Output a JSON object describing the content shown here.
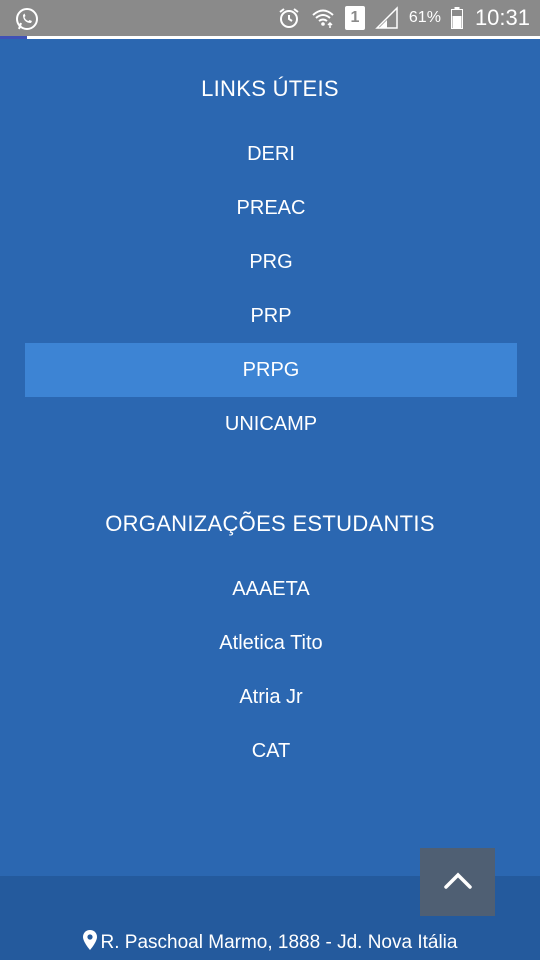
{
  "status_bar": {
    "sim_label": "1",
    "battery_pct": "61%",
    "time": "10:31"
  },
  "page_progress": 0.05,
  "links_section": {
    "title": "LINKS ÚTEIS",
    "items": [
      "DERI",
      "PREAC",
      "PRG",
      "PRP",
      "PRPG",
      "UNICAMP"
    ],
    "active_item": "PRPG"
  },
  "orgs_section": {
    "title": "ORGANIZAÇÕES ESTUDANTIS",
    "items": [
      "AAAETA",
      "Atletica Tito",
      "Atria Jr",
      "CAT"
    ]
  },
  "footer": {
    "address": "R. Paschoal Marmo, 1888 - Jd. Nova Itália"
  },
  "colors": {
    "background": "#2b67b1",
    "active_item": "#3d84d4",
    "footer": "#245a9d",
    "back_to_top": "#4f5f73"
  }
}
